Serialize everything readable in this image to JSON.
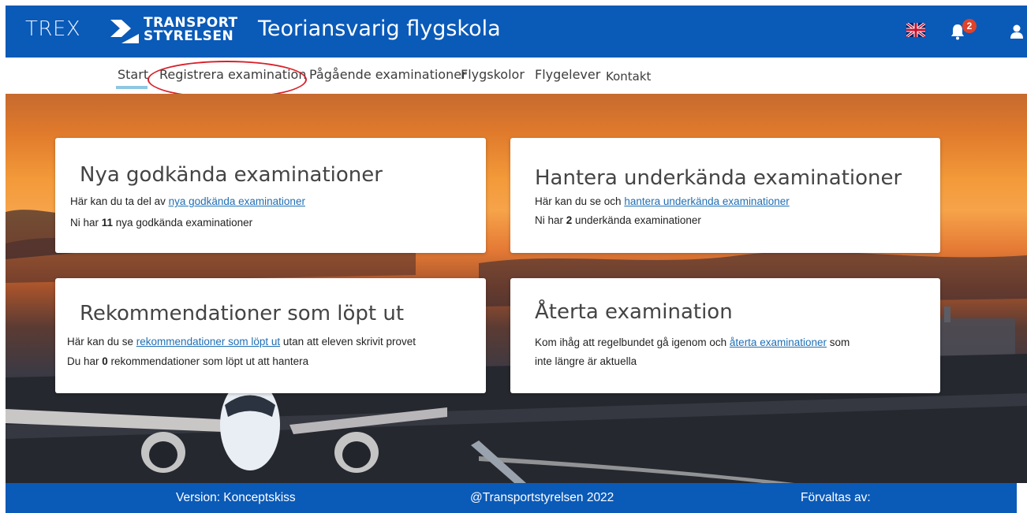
{
  "header": {
    "app_short": "TREX",
    "logo_line1": "TRANSPORT",
    "logo_line2": "STYRELSEN",
    "title": "Teoriansvarig flygskola",
    "notification_count": "2",
    "icons": [
      "uk-flag-icon",
      "bell-icon",
      "user-icon"
    ]
  },
  "nav": {
    "items": [
      "Start",
      "Registrera examination",
      "Pågående examinationer",
      "Flygskolor",
      "Flygelever",
      "Kontakt"
    ],
    "active": "Start"
  },
  "cards": [
    {
      "title": "Nya godkända examinationer",
      "line1_prefix": "Här kan du ta del av ",
      "line1_link": "nya godkända examinationer",
      "line2_prefix": "Ni har ",
      "line2_count": "11",
      "line2_suffix": " nya godkända examinationer"
    },
    {
      "title": "Hantera underkända examinationer",
      "line1_prefix": "Här kan du se och ",
      "line1_link": "hantera underkända examinationer",
      "line2_prefix": "Ni  har ",
      "line2_count": "2",
      "line2_suffix": " underkända examinationer"
    },
    {
      "title": "Rekommendationer som löpt ut",
      "line1_prefix": "Här kan du se ",
      "line1_link": "rekommendationer som löpt ut",
      "line1_suffix": " utan att eleven skrivit provet",
      "line2_prefix": "Du har ",
      "line2_count": "0",
      "line2_suffix": "  rekommendationer som löpt ut att hantera"
    },
    {
      "title": "Återta examination",
      "line1_prefix": "Kom ihåg att regelbundet gå igenom och ",
      "line1_link": "återta examinationer",
      "line1_suffix": "  som",
      "line2_text": "inte längre är aktuella"
    }
  ],
  "footer": {
    "version": "Version: Konceptskiss",
    "copyright": "@Transportstyrelsen 2022",
    "managed_by": "Förvaltas av:"
  },
  "colors": {
    "brand_blue": "#0a5ab8",
    "link_blue": "#1f6fb5",
    "badge_red": "#e0432a",
    "annotation_red": "#d9202a"
  }
}
